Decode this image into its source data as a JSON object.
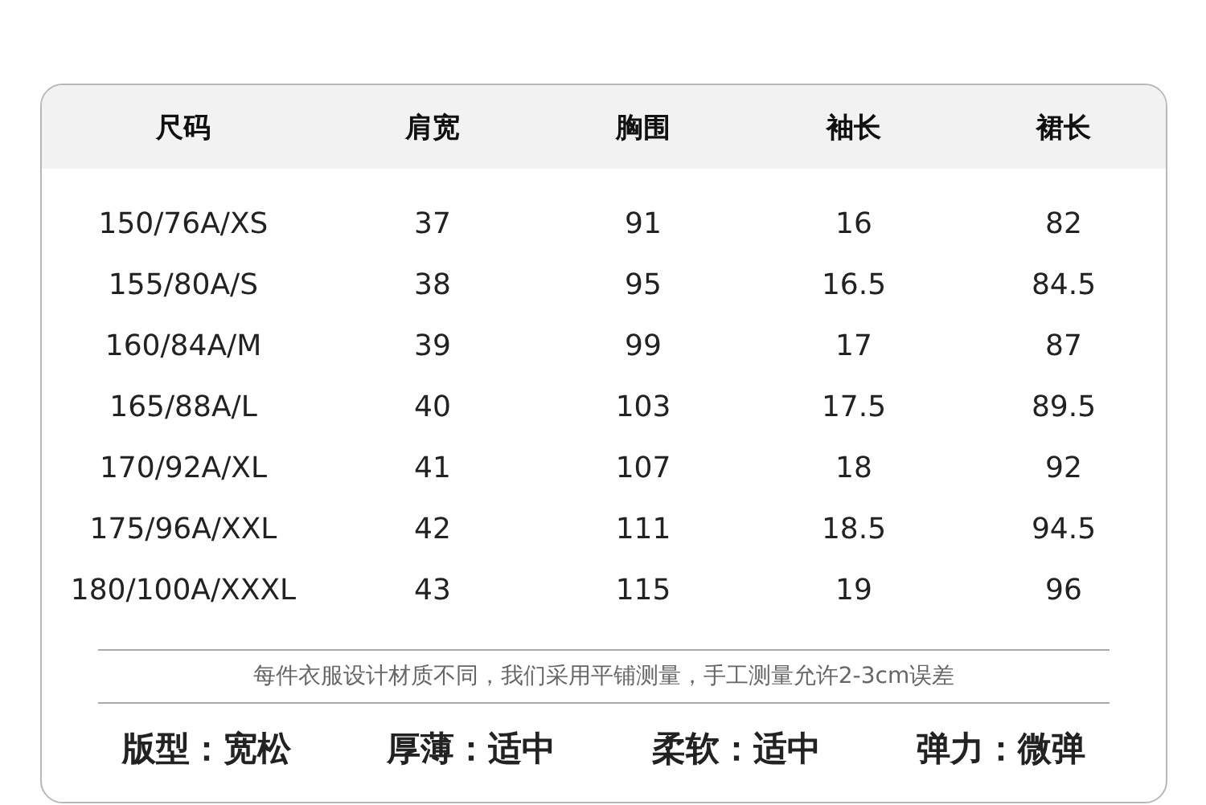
{
  "table": {
    "columns": [
      "尺码",
      "肩宽",
      "胸围",
      "袖长",
      "裙长"
    ],
    "rows": [
      [
        "150/76A/XS",
        "37",
        "91",
        "16",
        "82"
      ],
      [
        "155/80A/S",
        "38",
        "95",
        "16.5",
        "84.5"
      ],
      [
        "160/84A/M",
        "39",
        "99",
        "17",
        "87"
      ],
      [
        "165/88A/L",
        "40",
        "103",
        "17.5",
        "89.5"
      ],
      [
        "170/92A/XL",
        "41",
        "107",
        "18",
        "92"
      ],
      [
        "175/96A/XXL",
        "42",
        "111",
        "18.5",
        "94.5"
      ],
      [
        "180/100A/XXXL",
        "43",
        "115",
        "19",
        "96"
      ]
    ]
  },
  "note": "每件衣服设计材质不同，我们采用平铺测量，手工测量允许2-3cm误差",
  "attributes": [
    "版型：宽松",
    "厚薄：适中",
    "柔软：适中",
    "弹力：微弹"
  ]
}
